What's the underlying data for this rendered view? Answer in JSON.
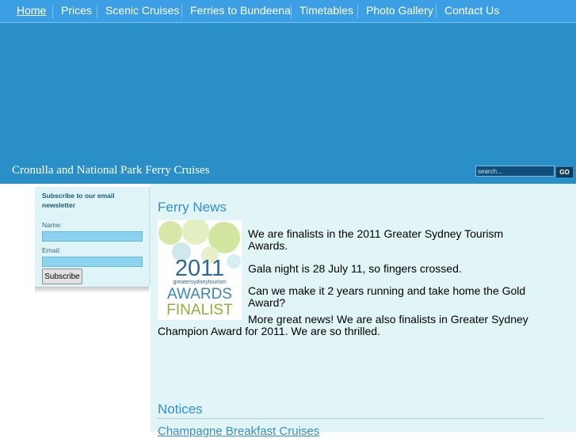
{
  "nav": {
    "items": [
      {
        "label": "Home"
      },
      {
        "label": "Prices"
      },
      {
        "label": "Scenic Cruises"
      },
      {
        "label": "Ferries to Bundeena"
      },
      {
        "label": "Timetables"
      },
      {
        "label": "Photo Gallery"
      },
      {
        "label": "Contact Us"
      }
    ],
    "active_index": 0
  },
  "header": {
    "site_title": "Cronulla and National Park Ferry Cruises",
    "search_placeholder": "search...",
    "go_label": "GO"
  },
  "newsletter": {
    "heading": "Subscribe to our email newsletter",
    "name_label": "Name:",
    "email_label": "Email:",
    "name_value": "",
    "email_value": "",
    "subscribe_label": "Subscribe"
  },
  "news": {
    "title": "Ferry News",
    "award_image": {
      "year": "2011",
      "brand": "greatersydneytourism",
      "line1": "AWARDS",
      "line2": "FINALIST"
    },
    "para1": "We are finalists in the 2011 Greater Sydney Tourism Awards.",
    "para2": "Gala night is 28 July 11, so fingers crossed.",
    "para3": "Can we make it 2 years running and take home the Gold Award?",
    "para4_start": "More great news!  We are also finalists in Greater Sydney",
    "para4_rest": "Champion Award for 2011.  We are so thrilled."
  },
  "notices": {
    "title": "Notices",
    "link": "Champagne Breakfast Cruises"
  },
  "colors": {
    "nav_bg": "#3d9fe3",
    "banner_bg": "#2b8fc7",
    "main_bg": "#e2f5f6",
    "accent": "#2f8fd0"
  }
}
